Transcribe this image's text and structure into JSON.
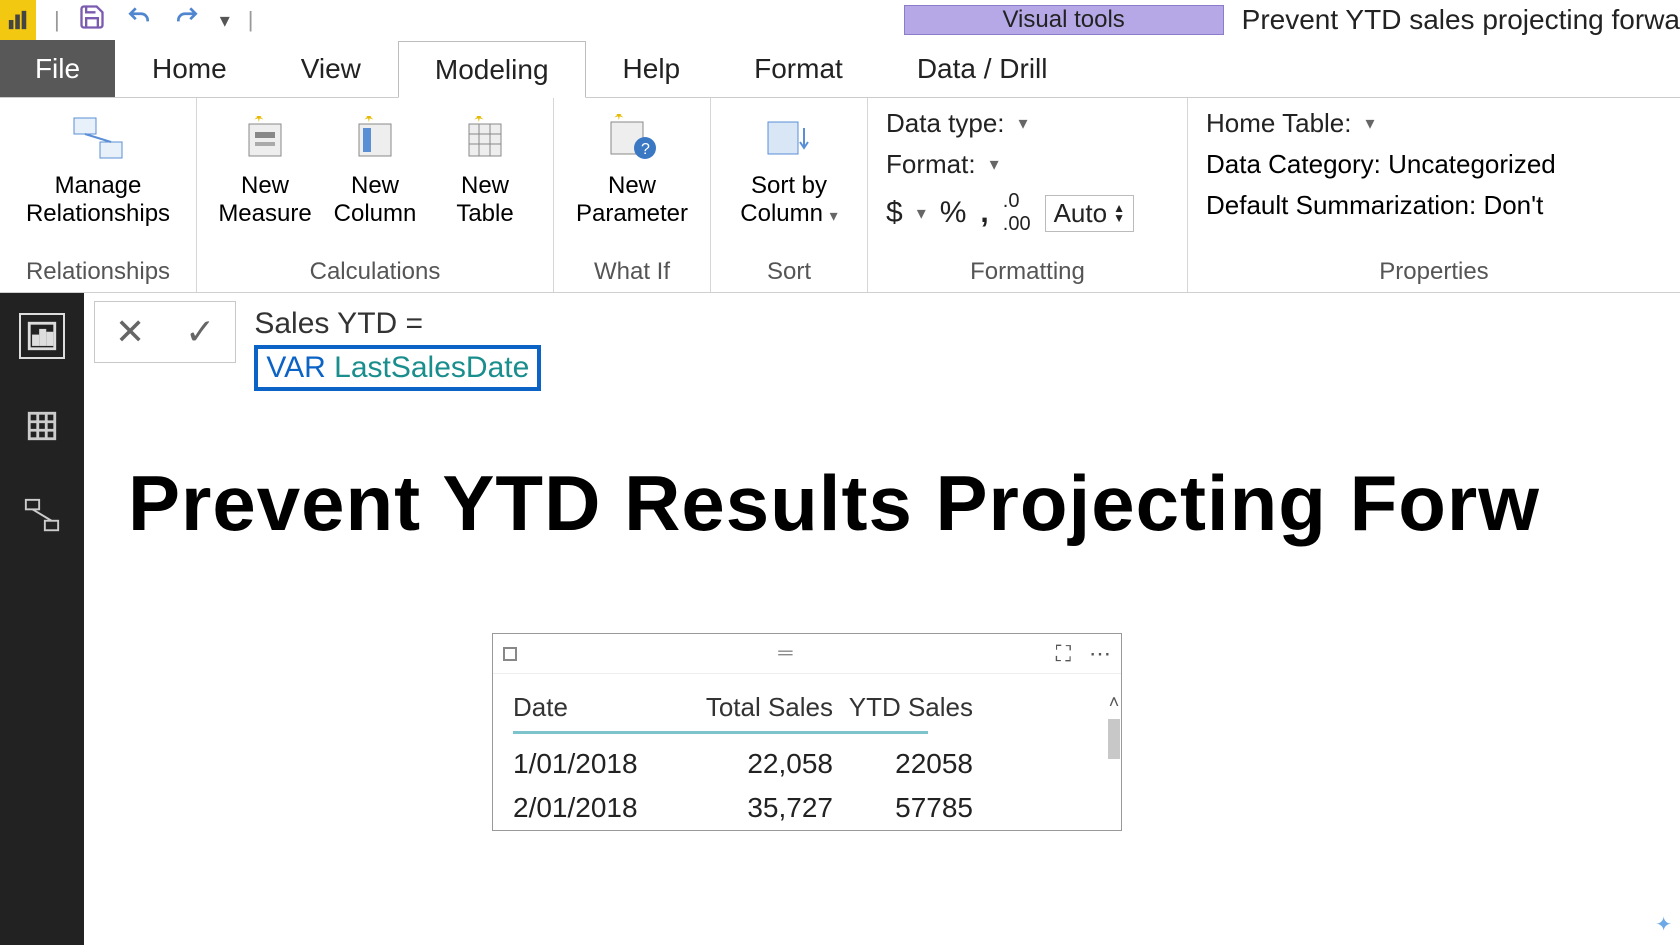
{
  "titlebar": {
    "visual_tools": "Visual tools",
    "doc_title": "Prevent YTD sales projecting forwa"
  },
  "tabs": {
    "file": "File",
    "home": "Home",
    "view": "View",
    "modeling": "Modeling",
    "help": "Help",
    "format": "Format",
    "data_drill": "Data / Drill"
  },
  "ribbon": {
    "relationships": {
      "manage": "Manage\nRelationships",
      "group": "Relationships"
    },
    "calculations": {
      "measure": "New\nMeasure",
      "column": "New\nColumn",
      "table": "New\nTable",
      "group": "Calculations"
    },
    "whatif": {
      "param": "New\nParameter",
      "group": "What If"
    },
    "sort": {
      "sort": "Sort by\nColumn",
      "group": "Sort"
    },
    "formatting": {
      "data_type": "Data type:",
      "format": "Format:",
      "auto": "Auto",
      "group": "Formatting"
    },
    "properties": {
      "home_table": "Home Table:",
      "data_category": "Data Category: Uncategorized",
      "default_sum": "Default Summarization: Don't",
      "group": "Properties"
    }
  },
  "formula": {
    "line1": "Sales YTD =",
    "kw": "VAR",
    "ident": "LastSalesDate"
  },
  "report": {
    "title": "Prevent YTD Results Projecting Forw"
  },
  "table": {
    "headers": [
      "Date",
      "Total Sales",
      "YTD Sales"
    ],
    "rows": [
      {
        "date": "1/01/2018",
        "total": "22,058",
        "ytd": "22058"
      },
      {
        "date": "2/01/2018",
        "total": "35,727",
        "ytd": "57785"
      }
    ]
  },
  "icons": {
    "currency": "$",
    "percent": "%",
    "comma": ",",
    "decimals": ".00",
    "focus": "⇱",
    "more": "⋯"
  }
}
